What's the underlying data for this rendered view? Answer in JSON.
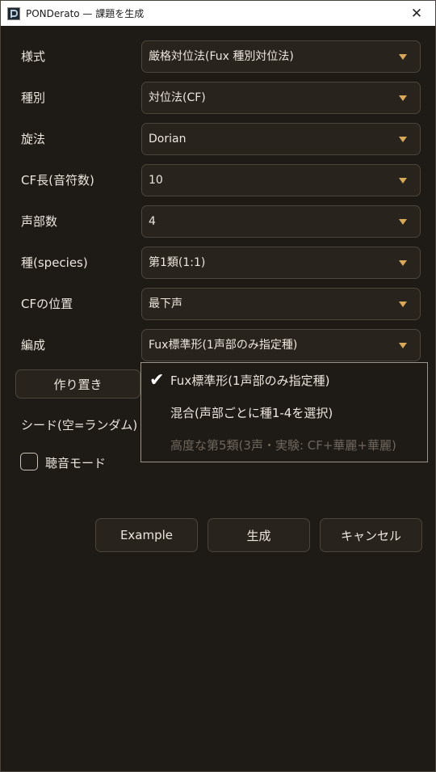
{
  "window": {
    "title": "PONDerato — 課題を生成",
    "close_glyph": "✕"
  },
  "fields": [
    {
      "label": "様式",
      "value": "厳格対位法(Fux 種別対位法)"
    },
    {
      "label": "種別",
      "value": "対位法(CF)"
    },
    {
      "label": "旋法",
      "value": "Dorian"
    },
    {
      "label": "CF長(音符数)",
      "value": "10"
    },
    {
      "label": "声部数",
      "value": "4"
    },
    {
      "label": "種(species)",
      "value": "第1類(1:1)"
    },
    {
      "label": "CFの位置",
      "value": "最下声"
    },
    {
      "label": "編成",
      "value": "Fux標準形(1声部のみ指定種)"
    }
  ],
  "dropdown": {
    "options": [
      {
        "label": "Fux標準形(1声部のみ指定種)",
        "selected": true,
        "enabled": true
      },
      {
        "label": "混合(声部ごとに種1-4を選択)",
        "selected": false,
        "enabled": true
      },
      {
        "label": "高度な第5類(3声・実験: CF+華麗+華麗)",
        "selected": false,
        "enabled": false
      }
    ],
    "check_glyph": "✔"
  },
  "sketch_button": "作り置き",
  "seed_label": "シード(空=ランダム)",
  "listening_mode": {
    "label": "聴音モード",
    "checked": false
  },
  "footer": {
    "example": "Example",
    "generate": "生成",
    "cancel": "キャンセル"
  },
  "colors": {
    "background": "#1e1a16",
    "control": "#28231d",
    "accent_caret": "#d9a95a",
    "text": "#ece6dd",
    "disabled_text": "#6d665d"
  }
}
